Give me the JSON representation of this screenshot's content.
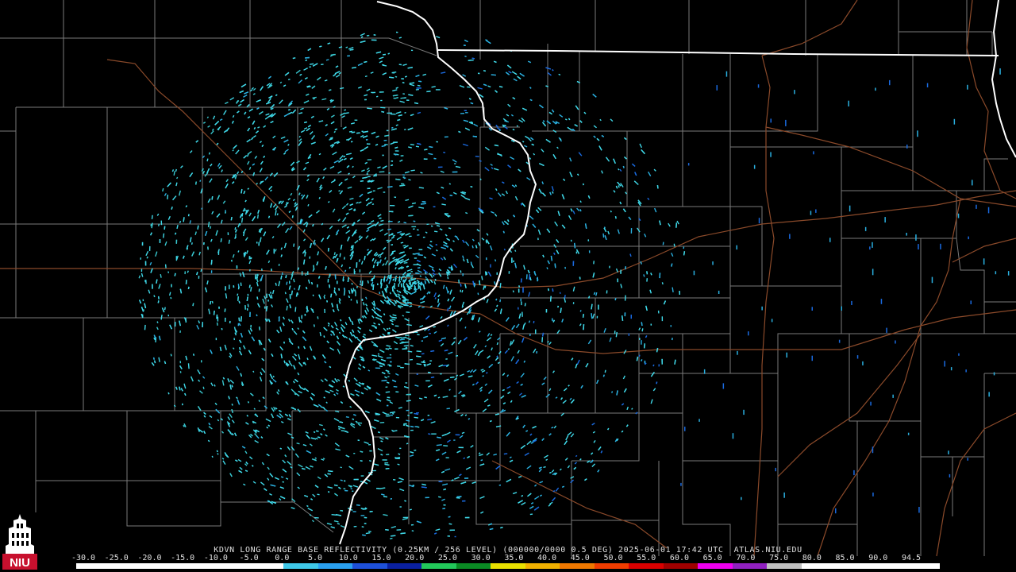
{
  "product": {
    "title": "KDVN LONG RANGE BASE REFLECTIVITY (0.25KM / 256 LEVEL) (000000/0000 0.5 DEG) 2025-06-01 17:42 UTC  ATLAS.NIU.EDU"
  },
  "logo": {
    "text": "NIU",
    "color": "#c8102e"
  },
  "legend": {
    "ticks": [
      "-30.0",
      "-25.0",
      "-20.0",
      "-15.0",
      "-10.0",
      "-5.0",
      "0.0",
      "5.0",
      "10.0",
      "15.0",
      "20.0",
      "25.0",
      "30.0",
      "35.0",
      "40.0",
      "45.0",
      "50.0",
      "55.0",
      "60.0",
      "65.0",
      "70.0",
      "75.0",
      "80.0",
      "85.0",
      "90.0",
      "94.5"
    ],
    "colors": [
      "#ffffff",
      "#ffffff",
      "#ffffff",
      "#ffffff",
      "#ffffff",
      "#ffffff",
      "#3fc8e8",
      "#2aa0f0",
      "#1e50d8",
      "#0a20a0",
      "#22c85a",
      "#0a8a24",
      "#e8e000",
      "#f0b000",
      "#f07800",
      "#f03c00",
      "#d80000",
      "#a00000",
      "#f000f0",
      "#9020c0",
      "#c0c0c0",
      "#ffffff",
      "#ffffff",
      "#ffffff",
      "#ffffff"
    ]
  },
  "map": {
    "background": "#000000",
    "county_line_color": "#7a7a7a",
    "state_line_color": "#ffffff",
    "highway_color": "#8b4a2a",
    "echo_colors": [
      "#3fd8e8",
      "#2ab0e0",
      "#1a6ae0",
      "#38c8d0"
    ]
  }
}
